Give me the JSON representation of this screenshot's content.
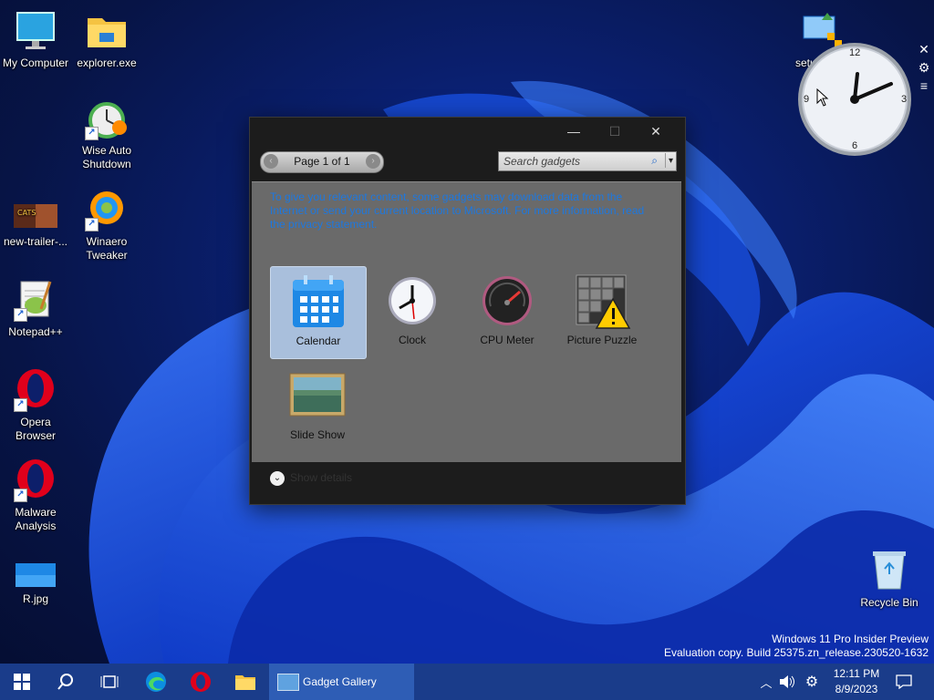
{
  "desktop": {
    "icons": [
      {
        "label": "My Computer"
      },
      {
        "label": "explorer.exe"
      },
      {
        "label": "Wise Auto Shutdown"
      },
      {
        "label": "new-trailer-..."
      },
      {
        "label": "Winaero Tweaker"
      },
      {
        "label": "Notepad++"
      },
      {
        "label": "Opera Browser"
      },
      {
        "label": "Malware Analysis"
      },
      {
        "label": "R.jpg"
      },
      {
        "label": "setu"
      },
      {
        "label": "Recycle Bin"
      }
    ],
    "watermark": {
      "line1": "Windows 11 Pro Insider Preview",
      "line2": "Evaluation copy. Build 25375.zn_release.230520-1632"
    }
  },
  "gadget_gallery": {
    "window_controls": {
      "minimize": "—",
      "maximize": "☐",
      "close": "✕"
    },
    "pager": {
      "text": "Page 1 of 1",
      "prev": "‹",
      "next": "›"
    },
    "search": {
      "placeholder": "Search gadgets",
      "dropdown": "▾"
    },
    "notice": "To give you relevant content, some gadgets may download data from the Internet or send your current location to Microsoft. For more information, read the privacy statement.",
    "gadgets": [
      {
        "label": "Calendar",
        "selected": true
      },
      {
        "label": "Clock"
      },
      {
        "label": "CPU Meter"
      },
      {
        "label": "Picture Puzzle"
      },
      {
        "label": "Slide Show"
      }
    ],
    "show_details": "Show details"
  },
  "clock_gadget": {
    "numbers": {
      "n12": "12",
      "n3": "3",
      "n6": "6",
      "n9": "9"
    },
    "controls": {
      "close": "✕",
      "settings": "⚙",
      "drag": "≡"
    }
  },
  "taskbar": {
    "active_window": "Gadget Gallery",
    "time": "12:11 PM",
    "date": "8/9/2023",
    "colors": {
      "taskbar": "#1a3c8a",
      "active": "#2e5db5"
    }
  }
}
